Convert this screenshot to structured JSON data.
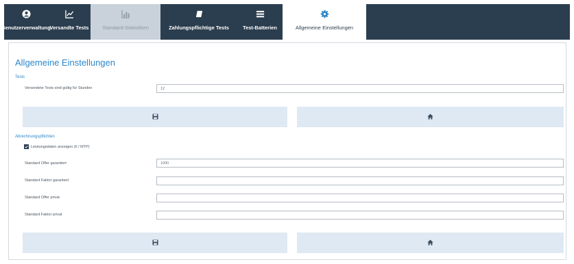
{
  "nav": {
    "tabs": [
      {
        "label": "Benutzerverwaltung",
        "icon": "user-circle-icon"
      },
      {
        "label": "Versandte Tests",
        "icon": "line-chart-icon"
      },
      {
        "label": "Standard-Statistiken",
        "icon": "bar-chart-icon"
      },
      {
        "label": "Zahlungspflichtige Tests",
        "icon": "credit-card-icon"
      },
      {
        "label": "Test-Batterien",
        "icon": "list-icon"
      },
      {
        "label": "Allgemeine Einstellungen",
        "icon": "gear-icon"
      }
    ],
    "active_tab": "Allgemeine Einstellungen"
  },
  "page": {
    "title": "Allgemeine Einstellungen",
    "tests_section": {
      "heading": "Tests",
      "fields": [
        {
          "label": "Versendete Tests sind gültig für Stunden",
          "value": "12",
          "placeholder": ""
        }
      ]
    },
    "abrechnung_section": {
      "heading": "Abrechnungspflichten",
      "checkbox": {
        "label": "Leistungsdaten anzeigen (€ / MTP)",
        "checked": true
      },
      "fields": [
        {
          "label": "Standard Offer garantiert",
          "value": "1000",
          "placeholder": ""
        },
        {
          "label": "Standard Faktor garantiert",
          "value": "",
          "placeholder": ""
        },
        {
          "label": "Standard Offer privat",
          "value": "",
          "placeholder": ""
        },
        {
          "label": "Standard Faktor privat",
          "value": "",
          "placeholder": ""
        }
      ]
    },
    "buttons": {
      "save_icon": "save-icon",
      "home_icon": "home-icon"
    }
  },
  "colors": {
    "nav_bg": "#2b3e4f",
    "accent": "#2d86c8",
    "button_bg": "#dfe9f4",
    "muted_tab_bg": "#c9d2da"
  }
}
